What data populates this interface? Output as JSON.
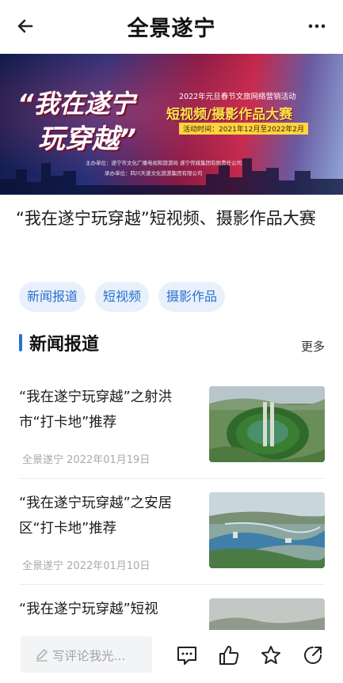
{
  "header": {
    "title": "全景遂宁",
    "back_icon": "back-arrow-icon",
    "more_icon": "more-dots-icon"
  },
  "banner": {
    "slogan_line1": "“我在遂宁",
    "slogan_line2": "玩穿越”",
    "subtitle": "2022年元旦春节文旅网络营销活动",
    "contest": "短视频/摄影作品大赛",
    "period": "活动时间：2021年12月至2022年2月",
    "organizer": "主办单位：遂宁市文化广播电视和旅游局    遂宁传媒集团有限责任公司",
    "co_organizer": "承办单位：四川天遂文化旅游集团有限公司"
  },
  "article": {
    "title": "“我在遂宁玩穿越”短视频、摄影作品大赛"
  },
  "tags": [
    "新闻报道",
    "短视频",
    "摄影作品"
  ],
  "section": {
    "label": "新闻报道",
    "more": "更多"
  },
  "news": [
    {
      "headline": "“我在遂宁玩穿越”之射洪市“打卡地”推荐",
      "source": "全景遂宁",
      "date": "2022年01月19日"
    },
    {
      "headline": "“我在遂宁玩穿越”之安居区“打卡地”推荐",
      "source": "全景遂宁",
      "date": "2022年01月10日"
    },
    {
      "headline": "“我在遂宁玩穿越”短视"
    }
  ],
  "bottom": {
    "comment_placeholder": "写评论我光...",
    "icons": [
      "comment-icon",
      "like-icon",
      "star-icon",
      "share-icon"
    ]
  },
  "colors": {
    "accent": "#2a6fd0",
    "tag_bg": "#e8f1fb"
  }
}
